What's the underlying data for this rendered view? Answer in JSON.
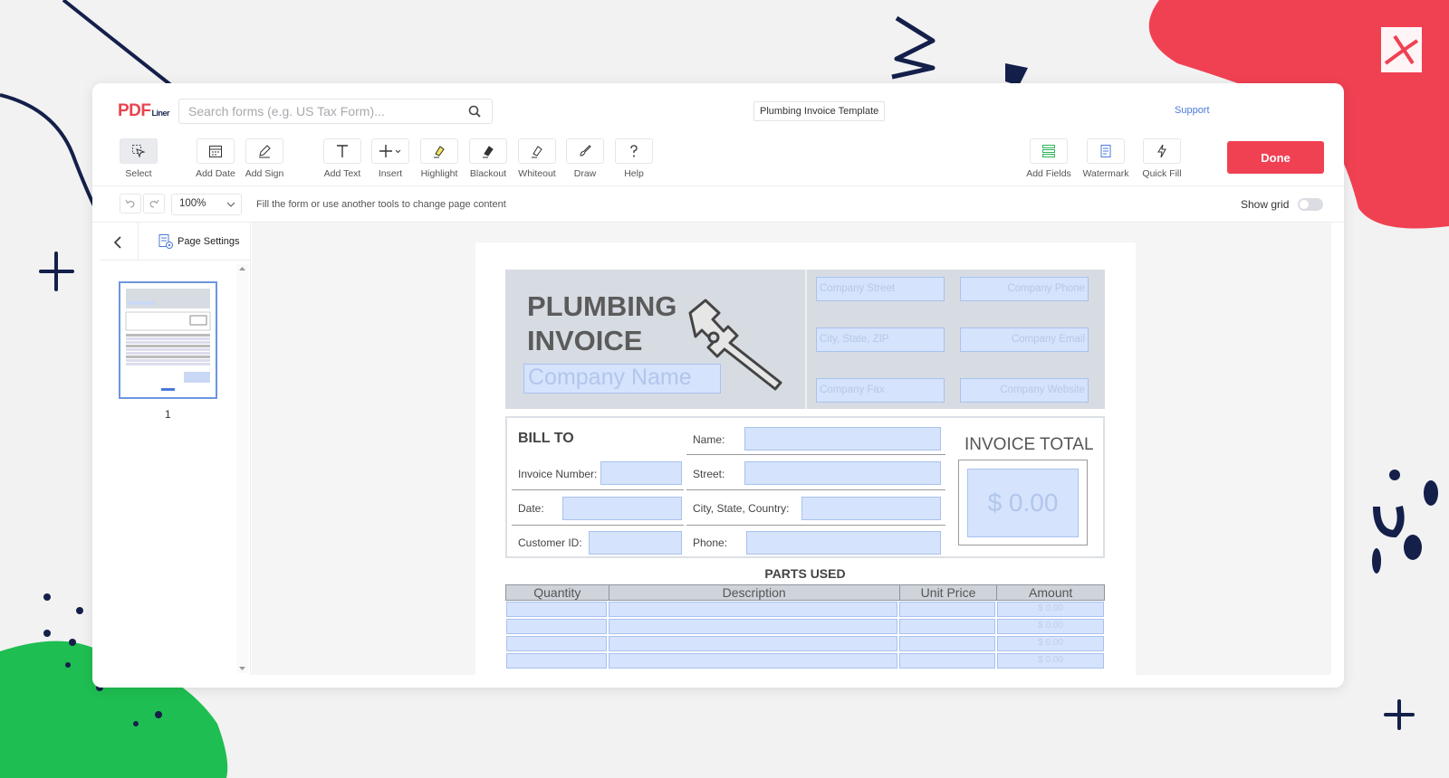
{
  "app": {
    "logo_main": "PDF",
    "logo_sub": "Liner",
    "search_placeholder": "Search forms (e.g. US Tax Form)...",
    "document_title": "Plumbing Invoice Template",
    "support_label": "Support"
  },
  "toolbar": {
    "tools": [
      {
        "label": "Select",
        "icon": "select-cursor-icon"
      },
      {
        "label": "Add Date",
        "icon": "calendar-icon"
      },
      {
        "label": "Add Sign",
        "icon": "pen-sign-icon"
      },
      {
        "label": "Add Text",
        "icon": "text-icon"
      },
      {
        "label": "Insert",
        "icon": "plus-icon"
      },
      {
        "label": "Highlight",
        "icon": "highlighter-icon"
      },
      {
        "label": "Blackout",
        "icon": "blackout-icon"
      },
      {
        "label": "Whiteout",
        "icon": "whiteout-icon"
      },
      {
        "label": "Draw",
        "icon": "draw-icon"
      },
      {
        "label": "Help",
        "icon": "help-icon"
      },
      {
        "label": "Add Fields",
        "icon": "fields-icon"
      },
      {
        "label": "Watermark",
        "icon": "watermark-icon"
      },
      {
        "label": "Quick Fill",
        "icon": "lightning-icon"
      }
    ],
    "done_label": "Done"
  },
  "subbar": {
    "zoom": "100%",
    "hint": "Fill the form or use another tools to change page content",
    "show_grid_label": "Show grid",
    "show_grid": false
  },
  "sidebar": {
    "page_settings_label": "Page Settings",
    "pages": [
      {
        "number": "1"
      }
    ]
  },
  "invoice": {
    "title_line1": "PLUMBING",
    "title_line2": "INVOICE",
    "company_name_placeholder": "Company Name",
    "header_fields": {
      "street": "Company Street",
      "phone": "Company Phone",
      "city": "City, State, ZIP",
      "email": "Company Email",
      "fax": "Company Fax",
      "website": "Company Website"
    },
    "bill_to_label": "BILL TO",
    "labels": {
      "invoice_number": "Invoice Number:",
      "date": "Date:",
      "customer_id": "Customer ID:",
      "name": "Name:",
      "street": "Street:",
      "city": "City, State, Country:",
      "phone": "Phone:"
    },
    "invoice_total_label": "INVOICE TOTAL",
    "invoice_total_value": "$ 0.00",
    "parts_used_label": "PARTS USED",
    "parts_columns": [
      "Quantity",
      "Description",
      "Unit Price",
      "Amount"
    ],
    "parts_rows": [
      {
        "amount": "$ 0.00"
      },
      {
        "amount": "$ 0.00"
      },
      {
        "amount": "$ 0.00"
      },
      {
        "amount": "$ 0.00"
      }
    ]
  },
  "colors": {
    "accent_red": "#f04152",
    "field_fill": "#d5e3fc",
    "header_band": "#d7dce3"
  }
}
